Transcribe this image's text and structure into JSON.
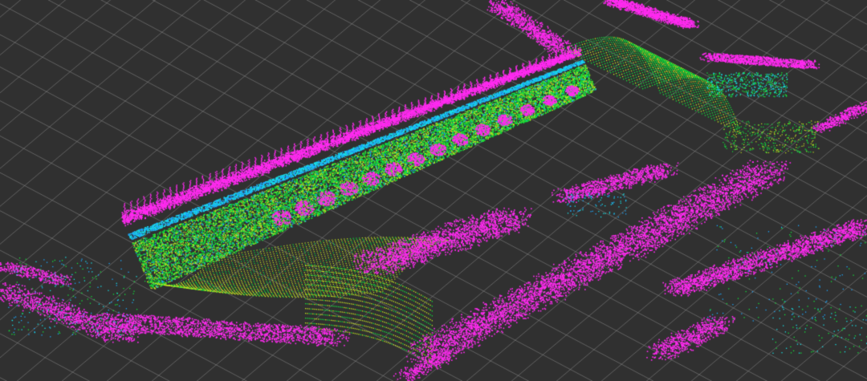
{
  "scene": {
    "icon": "lidar-point-cloud-icon",
    "colors": {
      "background": "#303030",
      "grid": "#8a8a8a",
      "high": "#ff2bf0",
      "mid": "#12e43a",
      "yellow": "#c6e820",
      "low": "#1ea8ff",
      "cyan": "#18e2e8"
    }
  }
}
